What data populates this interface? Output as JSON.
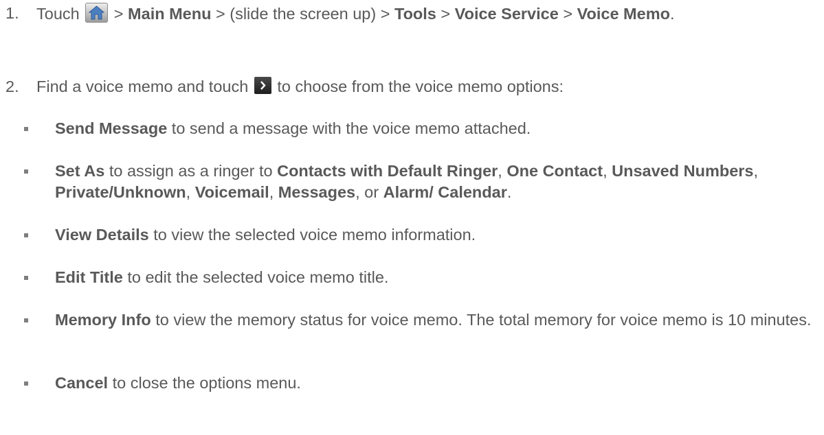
{
  "step1": {
    "number": "1.",
    "touch": "Touch",
    "sep1": ">",
    "main_menu": "Main Menu",
    "slide": "> (slide the screen up) >",
    "tools": "Tools",
    "sep2": ">",
    "voice_service": "Voice Service",
    "sep3": ">",
    "voice_memo": "Voice Memo",
    "period": "."
  },
  "step2": {
    "number": "2.",
    "text_before": "Find a voice memo and touch",
    "text_after": "to choose from the voice memo options:"
  },
  "options": {
    "send_message": {
      "label": "Send Message",
      "desc": "to send a message with the voice memo attached."
    },
    "set_as": {
      "label": "Set As",
      "desc": "to assign as a ringer to",
      "contacts_default": "Contacts with Default Ringer",
      "comma1": ",",
      "one_contact": "One Contact",
      "comma2": ",",
      "unsaved": "Unsaved Numbers",
      "comma3": ",",
      "private": "Private/Unknown",
      "comma4": ",",
      "voicemail": "Voicemail",
      "comma5": ",",
      "messages": "Messages",
      "or": ", or",
      "alarm": "Alarm/ Calendar",
      "period": "."
    },
    "view_details": {
      "label": "View Details",
      "desc": "to view the selected voice memo information."
    },
    "edit_title": {
      "label": "Edit Title",
      "desc": "to edit the selected voice memo title."
    },
    "memory_info": {
      "label": "Memory Info",
      "desc": "to view the memory status for voice memo. The total memory for voice memo is 10 minutes."
    },
    "cancel": {
      "label": "Cancel",
      "desc": "to close the options menu."
    }
  },
  "icons": {
    "home": "home-icon",
    "next": "chevron-right-icon"
  }
}
